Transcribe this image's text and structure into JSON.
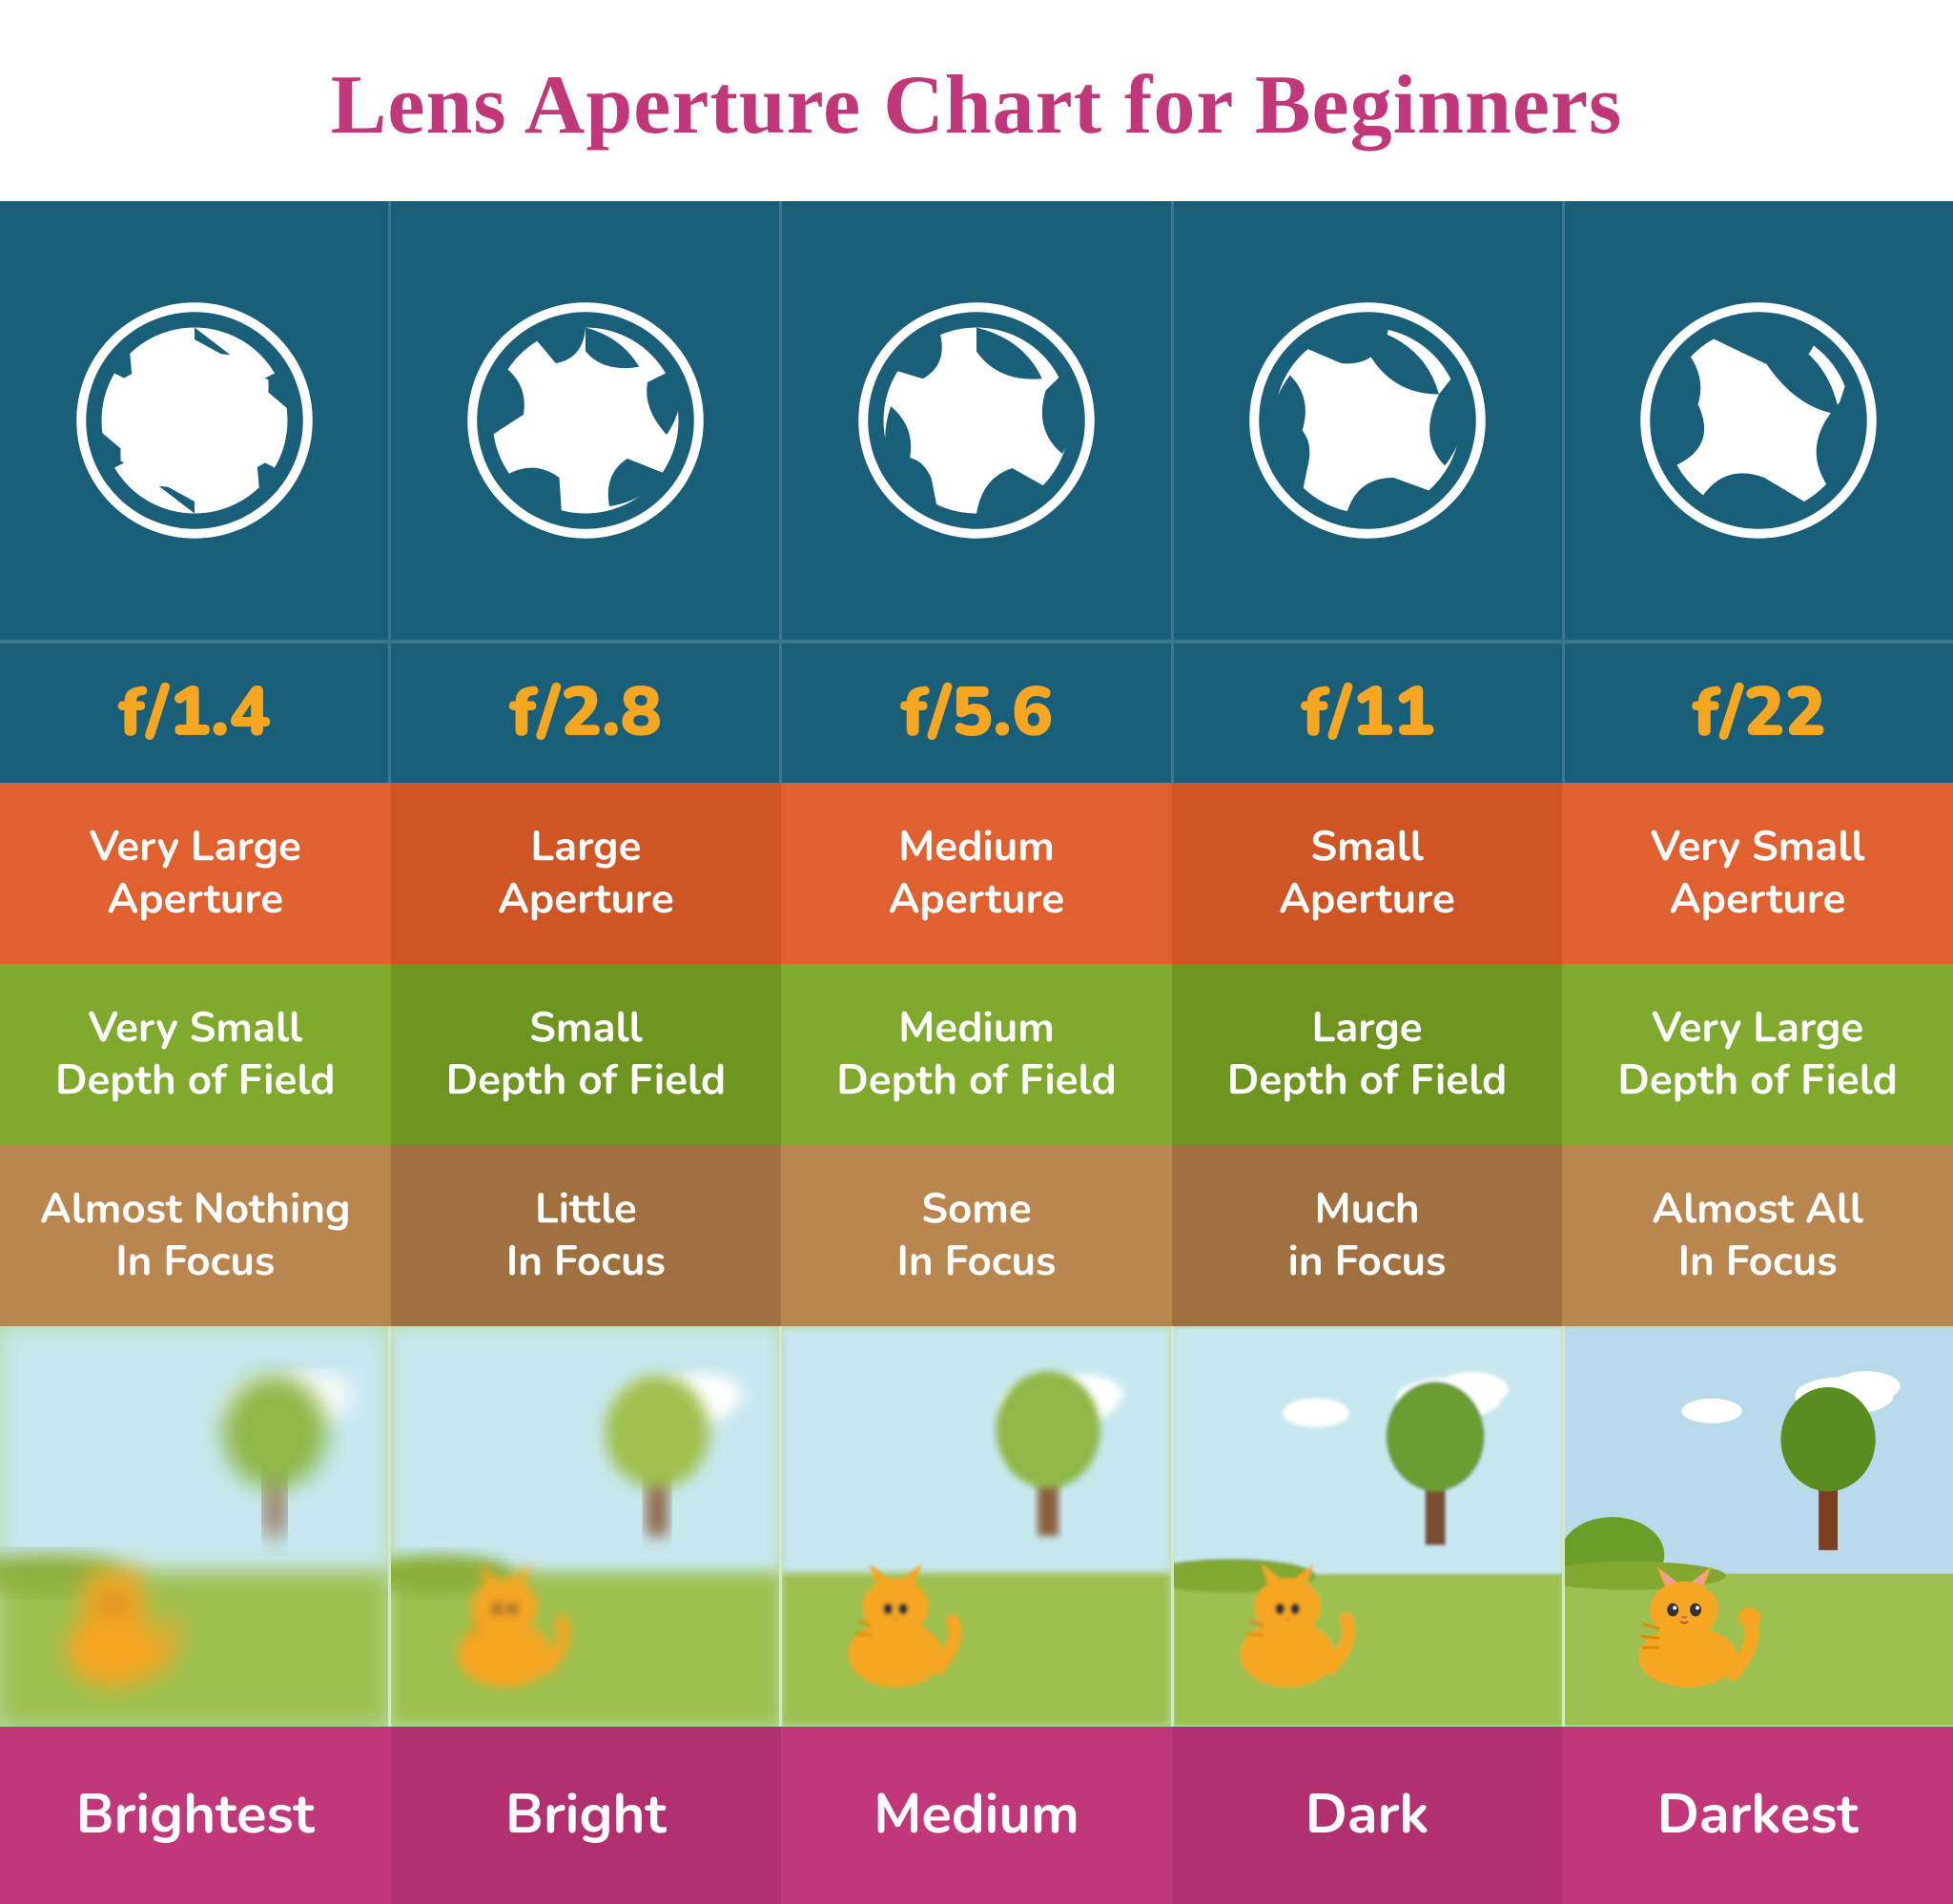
{
  "title": "Lens Aperture Chart for Beginners",
  "columns": [
    {
      "id": "col1",
      "fstop": "f/1.4",
      "aperture_label": "Very Large\nAperture",
      "dof_label": "Very Small\nDepth of Field",
      "focus_label": "Almost Nothing\nIn Focus",
      "brightness_label": "Brightest",
      "aperture_size": 0.95,
      "blur_level": "very-high"
    },
    {
      "id": "col2",
      "fstop": "f/2.8",
      "aperture_label": "Large\nAperture",
      "dof_label": "Small\nDepth of Field",
      "focus_label": "Little\nIn Focus",
      "brightness_label": "Bright",
      "aperture_size": 0.75,
      "blur_level": "high"
    },
    {
      "id": "col3",
      "fstop": "f/5.6",
      "aperture_label": "Medium\nAperture",
      "dof_label": "Medium\nDepth of Field",
      "focus_label": "Some\nIn Focus",
      "brightness_label": "Medium",
      "aperture_size": 0.5,
      "blur_level": "medium"
    },
    {
      "id": "col4",
      "fstop": "f/11",
      "aperture_label": "Small\nAperture",
      "dof_label": "Large\nDepth of Field",
      "focus_label": "Much\nin Focus",
      "brightness_label": "Dark",
      "aperture_size": 0.3,
      "blur_level": "low"
    },
    {
      "id": "col5",
      "fstop": "f/22",
      "aperture_label": "Very Small\nAperture",
      "dof_label": "Very Large\nDepth of Field",
      "focus_label": "Almost All\nIn Focus",
      "brightness_label": "Darkest",
      "aperture_size": 0.12,
      "blur_level": "none"
    }
  ],
  "colors": {
    "title": "#c0387a",
    "header_bg": "#1a5f7a",
    "fstop": "#f5a623",
    "aperture_odd": "#e06030",
    "aperture_even": "#c84e22",
    "dof_odd": "#7faa2e",
    "dof_even": "#6a9020",
    "focus_odd": "#b8864e",
    "focus_even": "#9e7040",
    "brightness": "#c0387a"
  }
}
